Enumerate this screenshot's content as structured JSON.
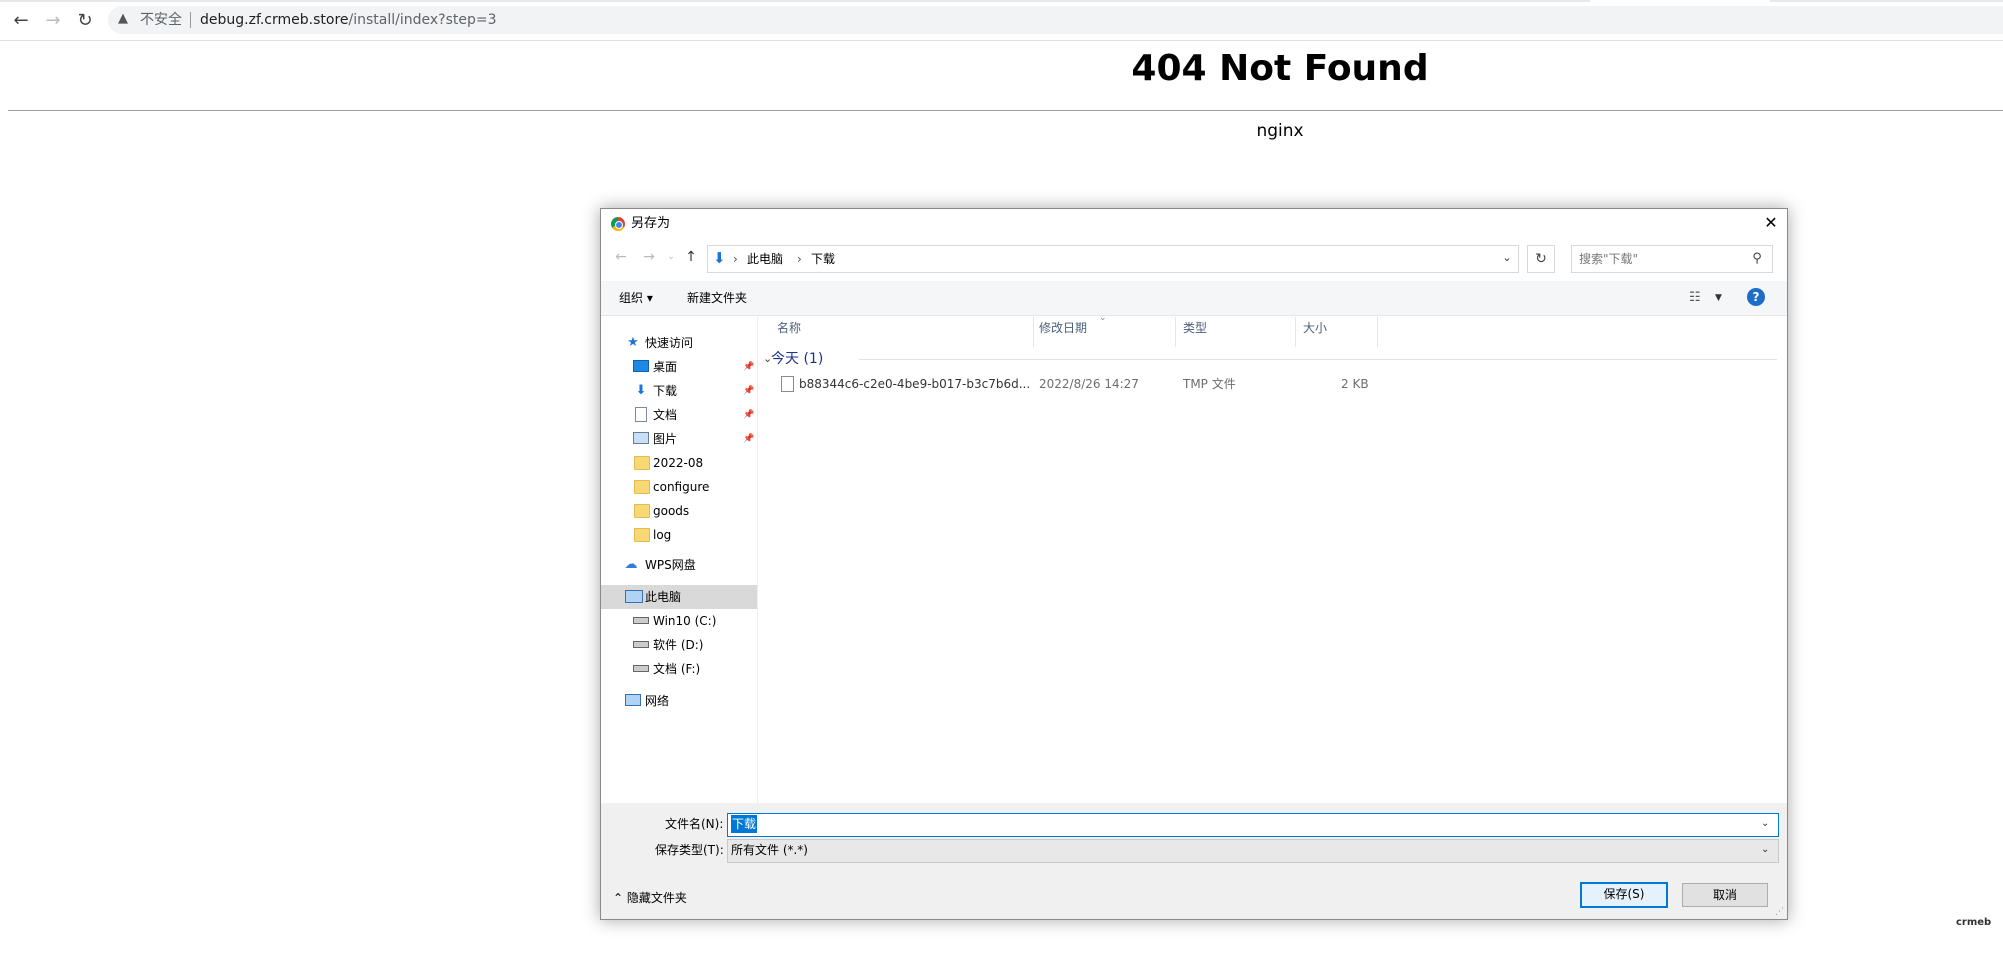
{
  "browser": {
    "security_label": "不安全",
    "url_host": "debug.zf.crmeb.store",
    "url_path": "/install/index?step=3"
  },
  "page": {
    "heading": "404 Not Found",
    "server": "nginx"
  },
  "dialog": {
    "title": "另存为",
    "breadcrumb": [
      "此电脑",
      "下载"
    ],
    "search_placeholder": "搜索\"下载\"",
    "toolbar": {
      "organize": "组织 ▾",
      "new_folder": "新建文件夹"
    },
    "nav": {
      "quick_access": "快速访问",
      "quick_items": [
        "桌面",
        "下载",
        "文档",
        "图片"
      ],
      "folders": [
        "2022-08",
        "configure",
        "goods",
        "log"
      ],
      "wps": "WPS网盘",
      "this_pc": "此电脑",
      "drives": [
        "Win10 (C:)",
        "软件 (D:)",
        "文档 (F:)"
      ],
      "network": "网络"
    },
    "columns": [
      "名称",
      "修改日期",
      "类型",
      "大小"
    ],
    "group_label": "今天 (1)",
    "files": [
      {
        "name": "b88344c6-c2e0-4be9-b017-b3c7b6d...",
        "modified": "2022/8/26 14:27",
        "type": "TMP 文件",
        "size": "2 KB"
      }
    ],
    "filename_label": "文件名(N):",
    "filename_value": "下载",
    "filetype_label": "保存类型(T):",
    "filetype_value": "所有文件 (*.*)",
    "hide_folders": "隐藏文件夹",
    "save_button": "保存(S)",
    "cancel_button": "取消"
  },
  "watermark": "crmeb",
  "colors": {
    "accent": "#0078d7",
    "help": "#1e6ec8",
    "folder": "#f8d775"
  }
}
